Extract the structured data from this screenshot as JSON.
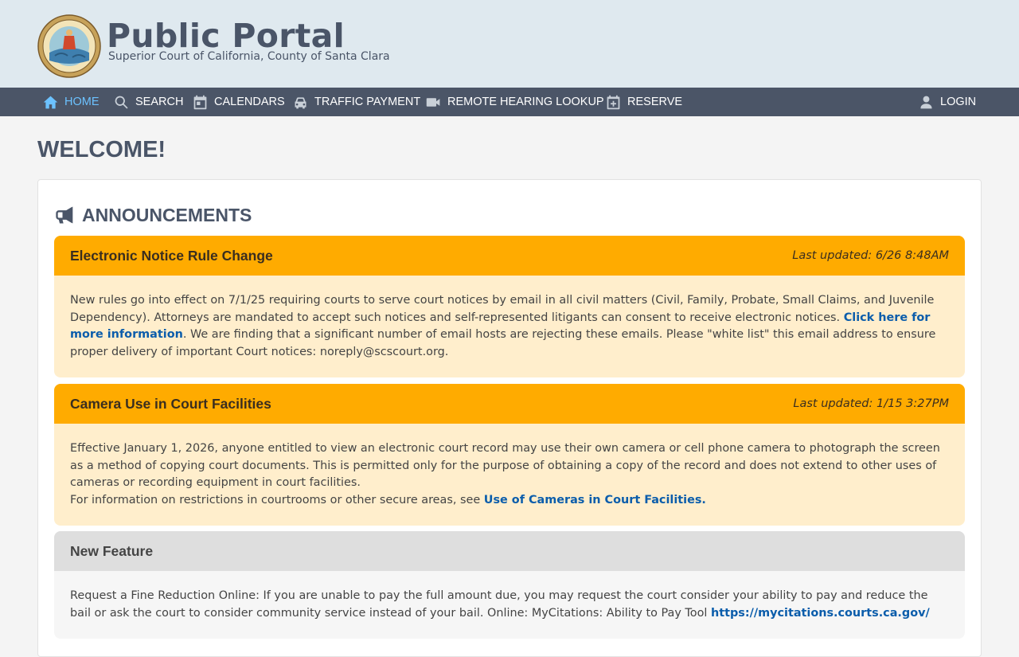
{
  "brand": {
    "title": "Public Portal",
    "subtitle": "Superior Court of California, County of Santa Clara",
    "seal_alt": "Superior Court of California County of Santa Clara seal"
  },
  "nav": {
    "home": "HOME",
    "search": "SEARCH",
    "calendars": "CALENDARS",
    "traffic_payment": "TRAFFIC PAYMENT",
    "remote_hearing": "REMOTE HEARING LOOKUP",
    "reserve": "RESERVE",
    "login": "LOGIN"
  },
  "page": {
    "welcome": "WELCOME!"
  },
  "announcements": {
    "heading": "ANNOUNCEMENTS",
    "items": [
      {
        "title": "Electronic Notice Rule Change",
        "updated": "Last updated: 6/26 8:48AM",
        "body_1": "New rules go into effect on 7/1/25 requiring courts to serve court notices by email in all civil matters (Civil, Family, Probate, Small Claims, and Juvenile Dependency). Attorneys are mandated to accept such notices and self-represented litigants can consent to receive electronic notices. ",
        "link": "Click here for more information",
        "body_2": ". We are finding that a significant number of email hosts are rejecting these emails. Please \"white list\" this email address to ensure proper delivery of important Court notices: noreply@scscourt.org."
      },
      {
        "title": "Camera Use in Court Facilities",
        "updated": "Last updated: 1/15 3:27PM",
        "body_1": "Effective January 1, 2026, anyone entitled to view an electronic court record may use their own camera or cell phone camera to photograph the screen as a method of copying court documents. This is permitted only for the purpose of obtaining a copy of the record and does not extend to other uses of cameras or recording equipment in court facilities.",
        "body_2": "For information on restrictions in courtrooms or other secure areas, see ",
        "link": "Use of Cameras in Court Facilities."
      },
      {
        "title": "New Feature",
        "body_1": "Request a Fine Reduction Online: If you are unable to pay the full amount due, you may request the court consider your ability to pay and reduce the bail or ask the court to consider community service instead of your bail. Online: MyCitations: Ability to Pay Tool ",
        "link": "https://mycitations.courts.ca.gov/"
      }
    ]
  },
  "colors": {
    "header_bg": "#dfe9ef",
    "nav_bg": "#4b5567",
    "nav_active": "#6cc2ff",
    "card_orange": "#ffab00",
    "card_orange_body": "#ffeecc",
    "card_grey": "#dedede",
    "link": "#0b5dab"
  },
  "icons": {
    "home": "home-icon",
    "search": "search-icon",
    "calendars": "calendar-icon",
    "traffic_payment": "car-icon",
    "remote_hearing": "video-camera-icon",
    "reserve": "calendar-plus-icon",
    "login": "user-icon",
    "announcements": "megaphone-icon"
  }
}
